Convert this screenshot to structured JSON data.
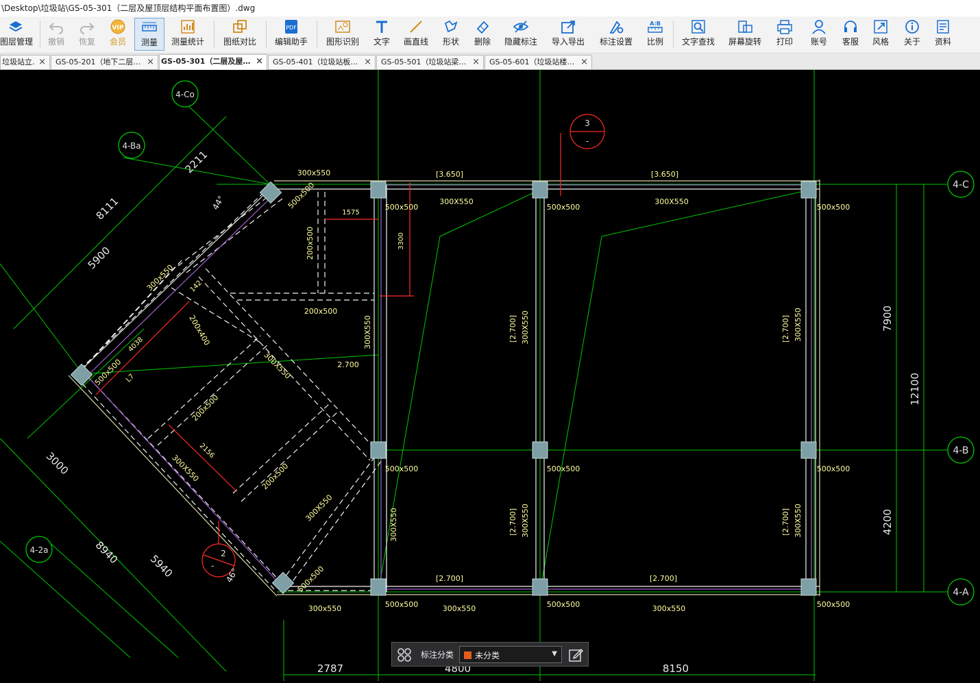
{
  "window": {
    "title": "\\Desktop\\垃圾站\\GS-05-301（二层及屋顶层结构平面布置图）.dwg"
  },
  "toolbar": {
    "layers": "图层管理",
    "undo": "撤销",
    "redo": "恢复",
    "vip": "会员",
    "measure": "测量",
    "measure_stats": "测量统计",
    "compare": "图纸对比",
    "edit_helper": "编辑助手",
    "shape_recog": "图形识别",
    "text": "文字",
    "line": "画直线",
    "shape": "形状",
    "delete": "删除",
    "hide_annot": "隐藏标注",
    "import_export": "导入导出",
    "annot_settings": "标注设置",
    "scale": "比例",
    "text_search": "文字查找",
    "rotate": "屏幕旋转",
    "print": "打印",
    "account": "账号",
    "service": "客服",
    "style": "风格",
    "about": "关于",
    "docs": "资料"
  },
  "tabs": [
    {
      "label": "垃圾站立…"
    },
    {
      "label": "GS-05-201（地下二层…"
    },
    {
      "label": "GS-05-301（二层及屋…"
    },
    {
      "label": "GS-05-401（垃圾站板…"
    },
    {
      "label": "GS-05-501（垃圾站梁…"
    },
    {
      "label": "GS-05-601（垃圾站楼…"
    }
  ],
  "tab_close": "×",
  "drawing": {
    "axes": {
      "c_right": "4-C",
      "b_right": "4-B",
      "a_right": "4-A",
      "co": "4-Co",
      "ba": "4-Ba",
      "a2": "4-2a"
    },
    "dims": {
      "d7900": "7900",
      "d12100": "12100",
      "d4200": "4200",
      "d2787": "2787",
      "d4800": "4800",
      "d8150": "8150",
      "d8111": "8111",
      "d5900": "5900",
      "d2211": "2211",
      "d3000": "3000",
      "d8940": "8940",
      "d5940": "5940",
      "d1575": "1575",
      "d3300": "3300",
      "d4038": "4038",
      "d2156": "2156",
      "d142": "142",
      "ang44": "44°",
      "ang46": "46°"
    },
    "labels": {
      "b300x550": "300x550",
      "b300X550": "300X550",
      "c500x500": "500x500",
      "b200x500": "200x500",
      "b200x400": "200x400",
      "elev3650": "[3.650]",
      "elev2700": "[2.700]",
      "lv2700": "2.700",
      "balloon1_top": "3",
      "balloon1_bot": "-",
      "balloon2_top": "2",
      "balloon2_bot": "-",
      "l7": "L7"
    }
  },
  "floatbar": {
    "label": "标注分类",
    "value": "未分类",
    "swatch_color": "#e65c1e"
  },
  "colors": {
    "grid": "#00c800",
    "beam": "#ffffff",
    "dim": "#00c000",
    "text": "#ffffa0",
    "measure": "#ff2a2a",
    "column": "#7f9fa6"
  },
  "icons": [
    "layers-icon",
    "undo-icon",
    "redo-icon",
    "vip-icon",
    "ruler-icon",
    "chart-icon",
    "compare-icon",
    "edit-icon",
    "shape-recog-icon",
    "text-icon",
    "line-icon",
    "shape-icon",
    "eraser-icon",
    "eye-hide-icon",
    "export-icon",
    "settings-icon",
    "scale-icon",
    "search-icon",
    "rotate-icon",
    "print-icon",
    "user-icon",
    "headset-icon",
    "resize-icon",
    "info-icon",
    "docs-icon"
  ]
}
